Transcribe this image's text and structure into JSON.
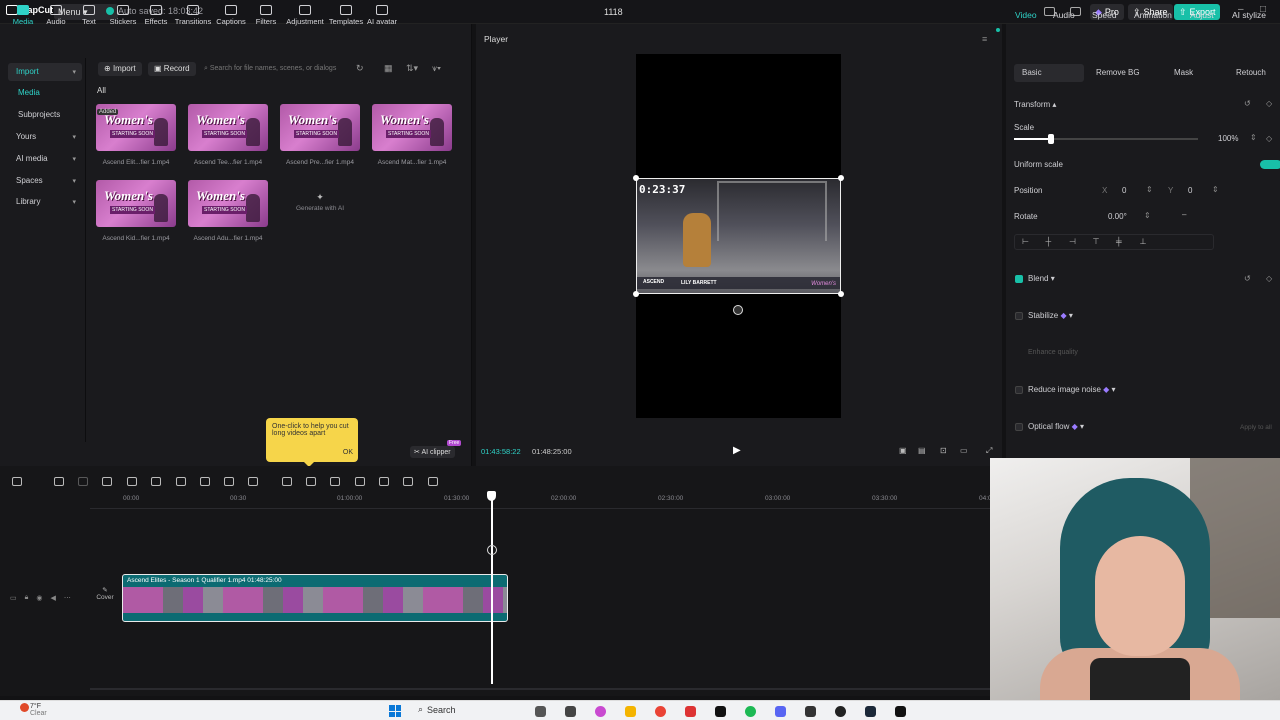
{
  "titlebar": {
    "app_name": "CapCut",
    "menu_label": "Menu",
    "autosave": "Auto saved: 18:03:42",
    "project_title": "1118",
    "pro_label": "Pro",
    "share_label": "Share",
    "export_label": "Export"
  },
  "toolbar": {
    "items": [
      "Media",
      "Audio",
      "Text",
      "Stickers",
      "Effects",
      "Transitions",
      "Captions",
      "Filters",
      "Adjustment",
      "Templates",
      "AI avatar"
    ]
  },
  "sidebar": {
    "items": [
      "Import",
      "Media",
      "Subprojects",
      "Yours",
      "AI media",
      "Spaces",
      "Library"
    ]
  },
  "media": {
    "import_label": "Import",
    "record_label": "Record",
    "search_placeholder": "Search for file names, scenes, or dialogs",
    "filter_label": "All",
    "added_badge": "Added",
    "thumb_title": "Women's",
    "thumb_sub": "STARTING SOON",
    "files": [
      "Ascend Elit...fier 1.mp4",
      "Ascend Tee...fier 1.mp4",
      "Ascend Pre...fier 1.mp4",
      "Ascend Mat...fier 1.mp4",
      "Ascend Kid...fier 1.mp4",
      "Ascend Adu...fier 1.mp4"
    ],
    "generate_label": "Generate with AI",
    "tooltip_text": "One-click to help you cut long videos apart",
    "tooltip_ok": "OK",
    "ai_clipper": "AI clipper",
    "ai_free": "Free"
  },
  "player": {
    "title": "Player",
    "current_time": "01:43:58:22",
    "total_time": "01:48:25:00",
    "clip_timer": "0:23:37",
    "clip_name": "LILY BARRETT",
    "clip_brand": "Women's",
    "clip_logo": "ASCEND"
  },
  "inspector": {
    "tabs": [
      "Video",
      "Audio",
      "Speed",
      "Animation",
      "Adjust",
      "AI stylize"
    ],
    "subtabs": [
      "Basic",
      "Remove BG",
      "Mask",
      "Retouch"
    ],
    "transform_label": "Transform",
    "scale_label": "Scale",
    "scale_value": "100%",
    "scale_level": 0.2,
    "uniform_scale_label": "Uniform scale",
    "position_label": "Position",
    "pos_x_label": "X",
    "pos_x": "0",
    "pos_y_label": "Y",
    "pos_y": "0",
    "rotate_label": "Rotate",
    "rotate_value": "0.00°",
    "blend_label": "Blend",
    "stabilize_label": "Stabilize",
    "enhance_label": "Enhance quality",
    "noise_label": "Reduce image noise",
    "optical_label": "Optical flow",
    "apply_label": "Apply to all"
  },
  "timeline": {
    "ticks": [
      "00:00",
      "00:30",
      "01:00:00",
      "01:30:00",
      "02:00:00",
      "02:30:00",
      "03:00:00",
      "03:30:00",
      "04:00"
    ],
    "track_label": "Ascend Elites - Season 1 Qualifier 1.mp4   01:48:25:00",
    "cover_label": "Cover"
  },
  "taskbar": {
    "weather_temp": "7°F",
    "weather_desc": "Clear",
    "search_label": "Search"
  },
  "colors": {
    "accent": "#2fd3c8",
    "export": "#18c0a8",
    "pro": "#6a3bd6"
  }
}
